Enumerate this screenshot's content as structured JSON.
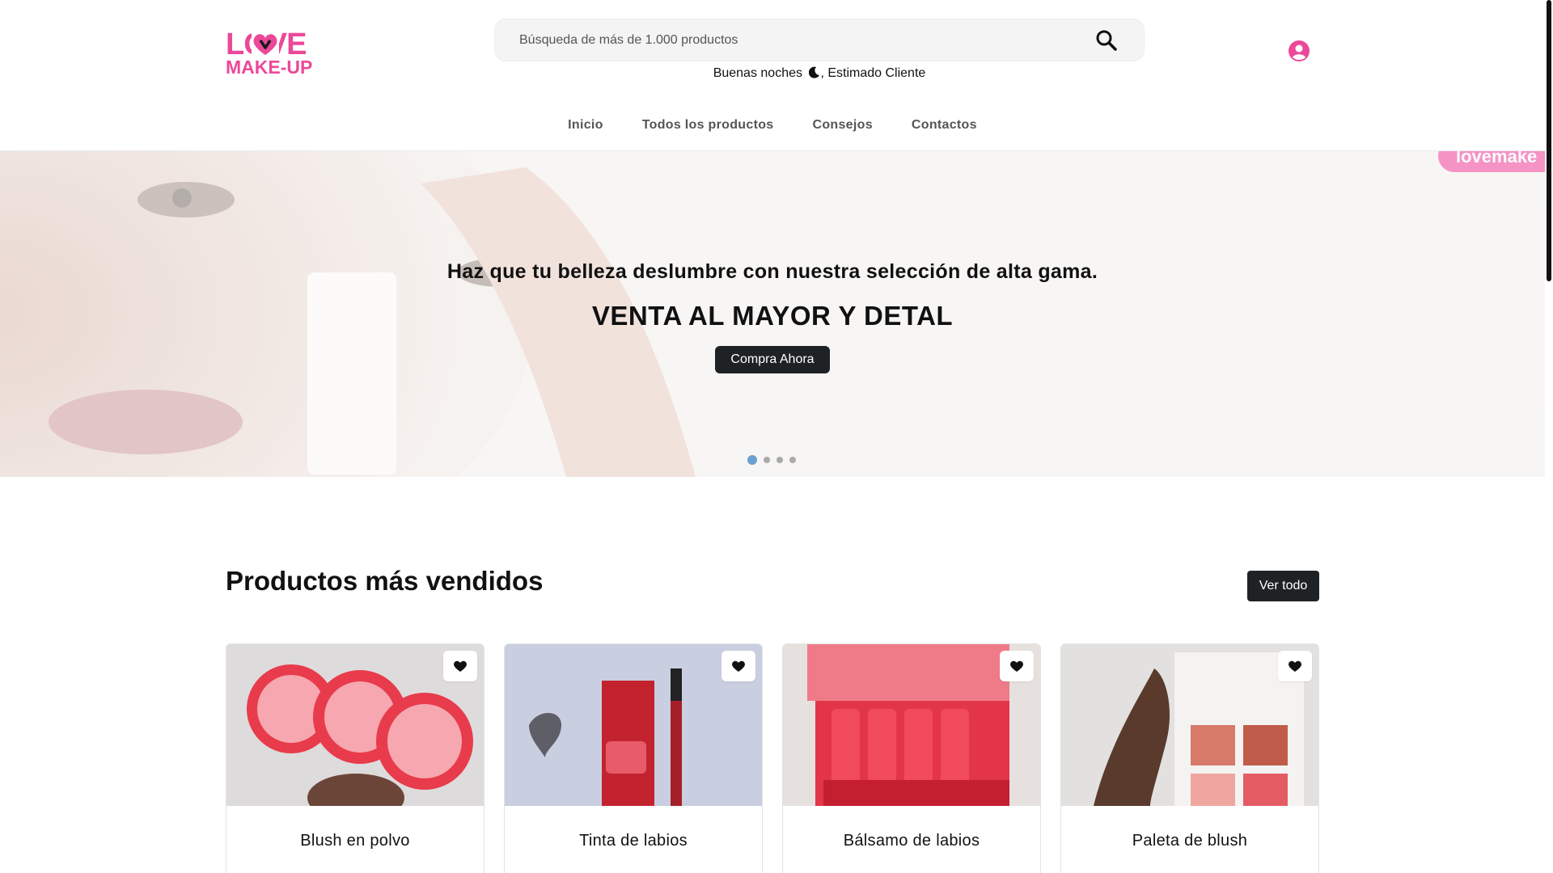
{
  "header": {
    "logo": {
      "line1": "LOVE",
      "line2": "MAKE-UP",
      "color": "#ec4899"
    },
    "search": {
      "placeholder": "Búsqueda de más de 1.000 productos",
      "icon": "search-icon"
    },
    "greeting": {
      "prefix": "Buenas noches",
      "icon": "moon-icon",
      "suffix": ", Estimado Cliente"
    },
    "user_icon": "user-circle-icon"
  },
  "nav": {
    "items": [
      {
        "label": "Inicio"
      },
      {
        "label": "Todos los productos"
      },
      {
        "label": "Consejos"
      },
      {
        "label": "Contactos"
      }
    ]
  },
  "hero": {
    "tag": "lovemake",
    "subtitle": "Haz que tu belleza deslumbre con nuestra selección de alta gama.",
    "title": "VENTA AL MAYOR Y DETAL",
    "cta": "Compra Ahora",
    "slides": 4,
    "active_slide": 1
  },
  "bestsellers": {
    "title": "Productos más vendidos",
    "view_all": "Ver todo",
    "favorite_icon": "heart-icon",
    "products": [
      {
        "name": "Blush en polvo"
      },
      {
        "name": "Tinta de labios"
      },
      {
        "name": "Bálsamo de labios"
      },
      {
        "name": "Paleta de blush"
      }
    ]
  },
  "colors": {
    "brand": "#ec4899",
    "dark_button": "#1f2225",
    "active_dot": "#6aa0cf"
  }
}
